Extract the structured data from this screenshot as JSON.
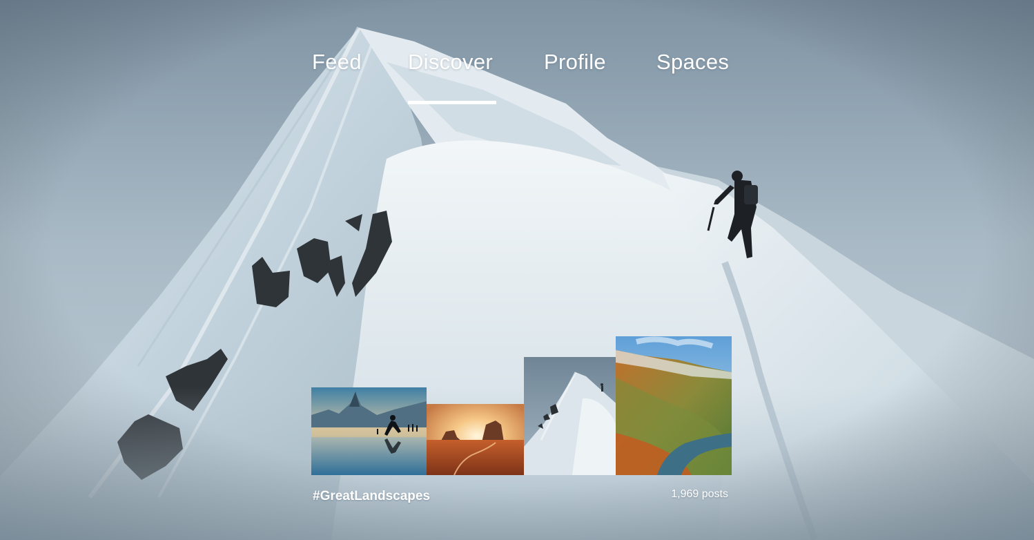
{
  "nav": {
    "tabs": [
      {
        "label": "Feed"
      },
      {
        "label": "Discover"
      },
      {
        "label": "Profile"
      },
      {
        "label": "Spaces"
      }
    ],
    "selected": "Discover"
  },
  "collection": {
    "title": "#GreatLandscapes",
    "count": "1,969 posts",
    "thumbnails": [
      "beach-runner-photo",
      "desert-sunset-photo",
      "snow-peak-climber-photo",
      "valley-road-photo"
    ]
  },
  "colors": {
    "text": "#ffffff",
    "sky": "#9fb0bd",
    "snow": "#e6eef2"
  }
}
